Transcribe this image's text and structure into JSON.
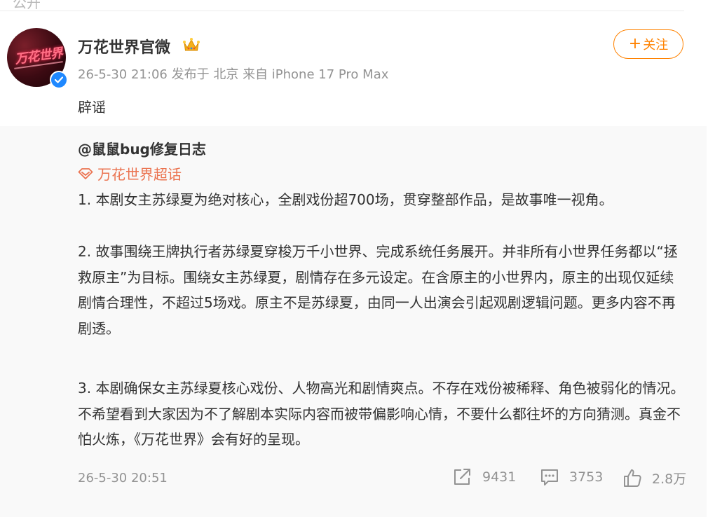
{
  "top_fragment": "公开",
  "post": {
    "author": "万花世界官微",
    "avatar_text": "万花世界",
    "time": "26-5-30 21:06",
    "published_from": "发布于 北京",
    "device": "来自 iPhone 17 Pro Max",
    "follow_label": "关注",
    "text": "辟谣"
  },
  "repost": {
    "author": "@鼠鼠bug修复日志",
    "topic": "万花世界超话",
    "paragraphs": [
      "1. 本剧女主苏绿夏为绝对核心，全剧戏份超700场，贯穿整部作品，是故事唯一视角。",
      "2. 故事围绕王牌执行者苏绿夏穿梭万千小世界、完成系统任务展开。并非所有小世界任务都以“拯救原主”为目标。围绕女主苏绿夏，剧情存在多元设定。在含原主的小世界内，原主的出现仅延续剧情合理性，不超过5场戏。原主不是苏绿夏，由同一人出演会引起观剧逻辑问题。更多内容不再剧透。",
      "3. 本剧确保女主苏绿夏核心戏份、人物高光和剧情爽点。不存在戏份被稀释、角色被弱化的情况。不希望看到大家因为不了解剧本实际内容而被带偏影响心情，不要什么都往坏的方向猜测。真金不怕火炼，《万花世界》会有好的呈现。"
    ],
    "time": "26-5-30 20:51",
    "reposts": "9431",
    "comments": "3753",
    "likes": "2.8万"
  },
  "colors": {
    "accent": "#ff8200",
    "topic": "#eb7350",
    "meta": "#939393",
    "verify": "#1e88ff"
  },
  "icons": [
    "crown-icon",
    "verified-icon",
    "topic-diamond-icon",
    "repost-icon",
    "comment-icon",
    "like-icon"
  ]
}
